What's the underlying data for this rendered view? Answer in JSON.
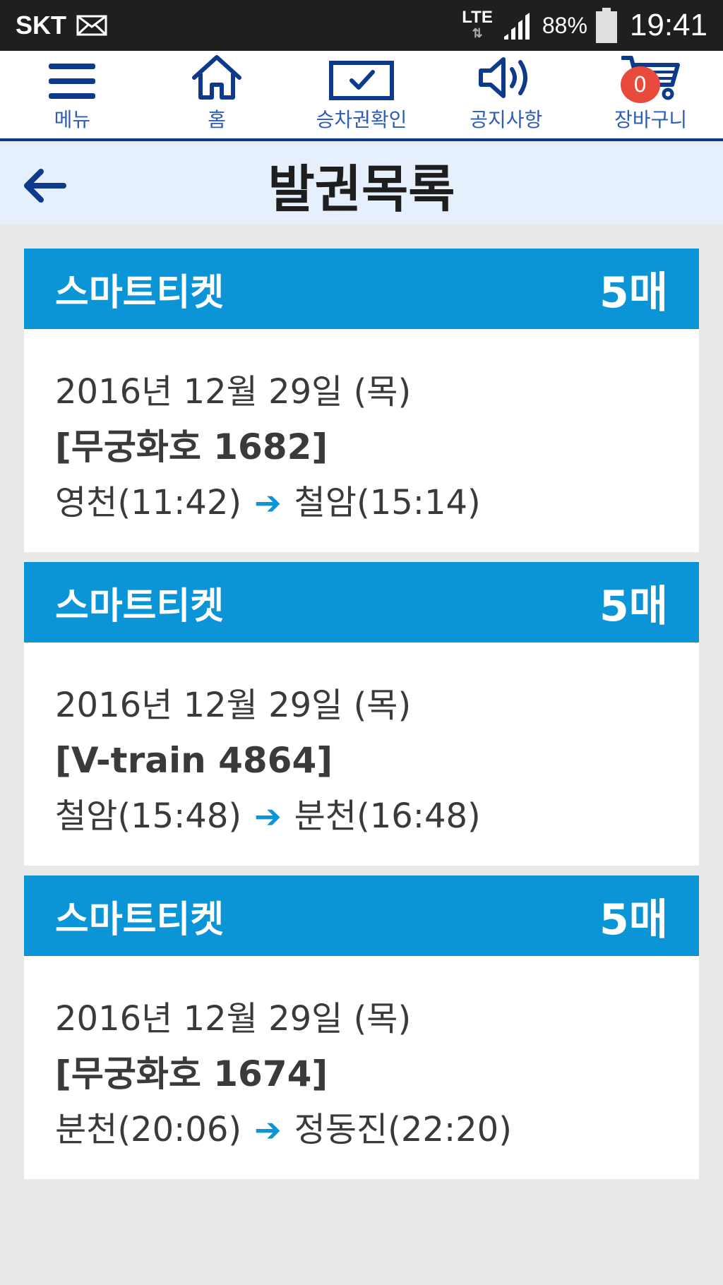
{
  "status_bar": {
    "carrier": "SKT",
    "network": "LTE",
    "battery": "88%",
    "time": "19:41"
  },
  "nav": {
    "menu": "메뉴",
    "home": "홈",
    "ticket_check": "승차권확인",
    "notice": "공지사항",
    "cart": "장바구니",
    "cart_count": "0"
  },
  "title_bar": {
    "title": "발권목록"
  },
  "tickets": [
    {
      "type": "스마트티켓",
      "count": "5매",
      "date": "2016년 12월 29일 (목)",
      "train": "[무궁화호 1682]",
      "from": "영천(11:42)",
      "to": "철암(15:14)"
    },
    {
      "type": "스마트티켓",
      "count": "5매",
      "date": "2016년 12월 29일 (목)",
      "train": "[V-train 4864]",
      "from": "철암(15:48)",
      "to": "분천(16:48)"
    },
    {
      "type": "스마트티켓",
      "count": "5매",
      "date": "2016년 12월 29일 (목)",
      "train": "[무궁화호 1674]",
      "from": "분천(20:06)",
      "to": "정동진(22:20)"
    }
  ],
  "colors": {
    "accent": "#0b94d6",
    "nav_blue": "#0d3a8a",
    "badge_red": "#e84b3c"
  }
}
